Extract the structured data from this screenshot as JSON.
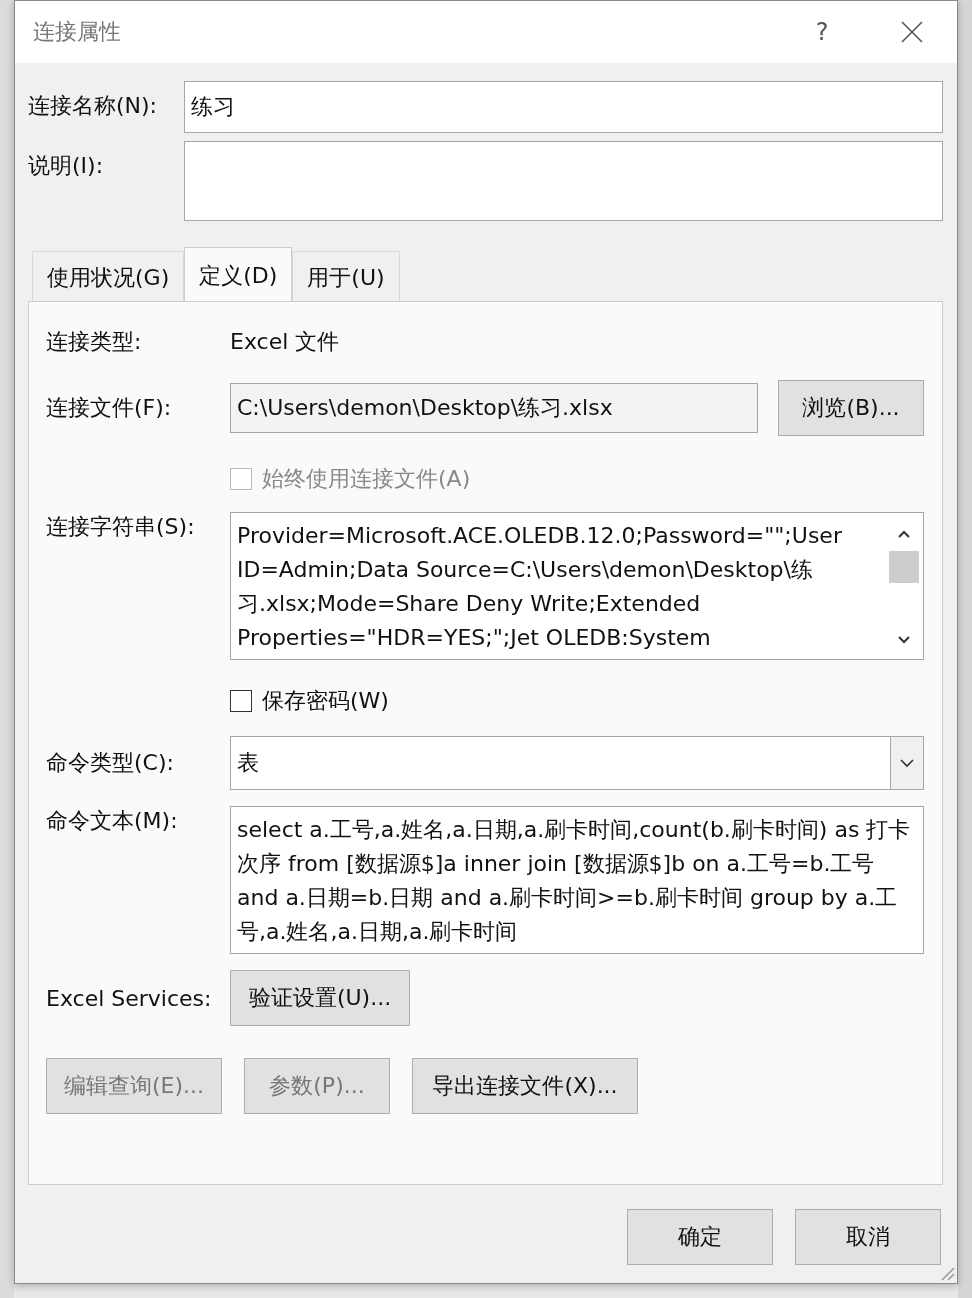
{
  "window": {
    "title": "连接属性",
    "help": "?"
  },
  "name_field": {
    "label": "连接名称(N):",
    "value": "练习"
  },
  "description_field": {
    "label": "说明(I):"
  },
  "tabs": [
    {
      "label": "使用状况(G)",
      "selected": false
    },
    {
      "label": "定义(D)",
      "selected": true
    },
    {
      "label": "用于(U)",
      "selected": false
    }
  ],
  "connection_type": {
    "label": "连接类型:",
    "value": "Excel 文件"
  },
  "connection_file": {
    "label": "连接文件(F):",
    "value": "C:\\Users\\demon\\Desktop\\练习.xlsx",
    "browse": "浏览(B)..."
  },
  "always_use_file": {
    "label": "始终使用连接文件(A)",
    "checked": false,
    "disabled": true
  },
  "connection_string": {
    "label": "连接字符串(S):",
    "value": "Provider=Microsoft.ACE.OLEDB.12.0;Password=\"\";User ID=Admin;Data Source=C:\\Users\\demon\\Desktop\\练习.xlsx;Mode=Share Deny Write;Extended Properties=\"HDR=YES;\";Jet OLEDB:System"
  },
  "save_password": {
    "label": "保存密码(W)",
    "checked": false,
    "disabled": false
  },
  "command_type": {
    "label": "命令类型(C):",
    "value": "表"
  },
  "command_text": {
    "label": "命令文本(M):",
    "value": "select a.工号,a.姓名,a.日期,a.刷卡时间,count(b.刷卡时间) as 打卡次序 from [数据源$]a inner join [数据源$]b on a.工号=b.工号 and a.日期=b.日期 and a.刷卡时间>=b.刷卡时间 group by a.工号,a.姓名,a.日期,a.刷卡时间"
  },
  "excel_services": {
    "label": "Excel Services:",
    "button": "验证设置(U)..."
  },
  "action_buttons": [
    {
      "label": "编辑查询(E)...",
      "disabled": true
    },
    {
      "label": "参数(P)...",
      "disabled": true
    },
    {
      "label": "导出连接文件(X)...",
      "disabled": false
    }
  ],
  "footer_buttons": [
    {
      "label": "确定"
    },
    {
      "label": "取消"
    }
  ]
}
